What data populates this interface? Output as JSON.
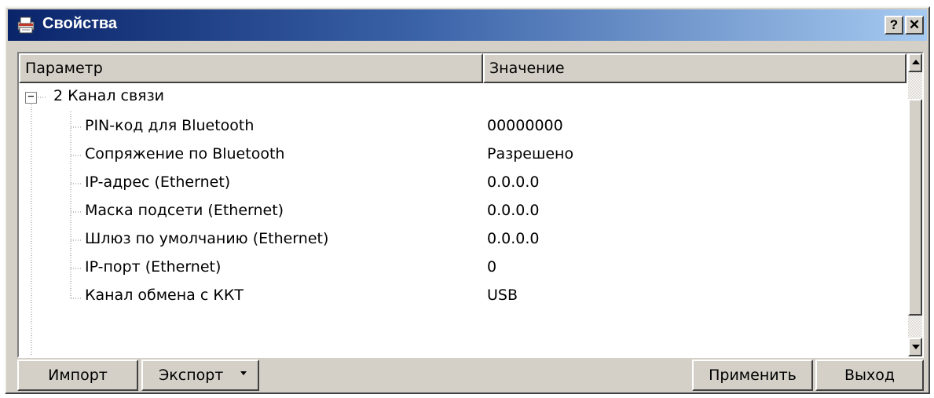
{
  "window": {
    "title": "Свойства",
    "help_label": "?",
    "close_label": "✕"
  },
  "columns": {
    "param": "Параметр",
    "value": "Значение"
  },
  "group": {
    "expander": "−",
    "label": "2 Канал связи"
  },
  "rows": [
    {
      "param": "PIN-код для Bluetooth",
      "value": "00000000"
    },
    {
      "param": "Сопряжение по Bluetooth",
      "value": "Разрешено"
    },
    {
      "param": "IP-адрес (Ethernet)",
      "value": "0.0.0.0"
    },
    {
      "param": "Маска подсети (Ethernet)",
      "value": "0.0.0.0"
    },
    {
      "param": "Шлюз по умолчанию (Ethernet)",
      "value": "0.0.0.0"
    },
    {
      "param": "IP-порт (Ethernet)",
      "value": "0"
    },
    {
      "param": "Канал обмена с ККТ",
      "value": "USB"
    }
  ],
  "buttons": {
    "import": "Импорт",
    "export": "Экспорт",
    "apply": "Применить",
    "exit": "Выход"
  },
  "icons": {
    "app": "printer-icon",
    "help": "help-icon",
    "close": "close-icon",
    "expander": "collapse-icon",
    "export_dropdown": "chevron-down-icon",
    "scroll_up": "arrow-up-icon",
    "scroll_down": "arrow-down-icon"
  },
  "colors": {
    "title_start": "#0a246a",
    "title_end": "#a6caf0",
    "face": "#d4d0c8"
  }
}
